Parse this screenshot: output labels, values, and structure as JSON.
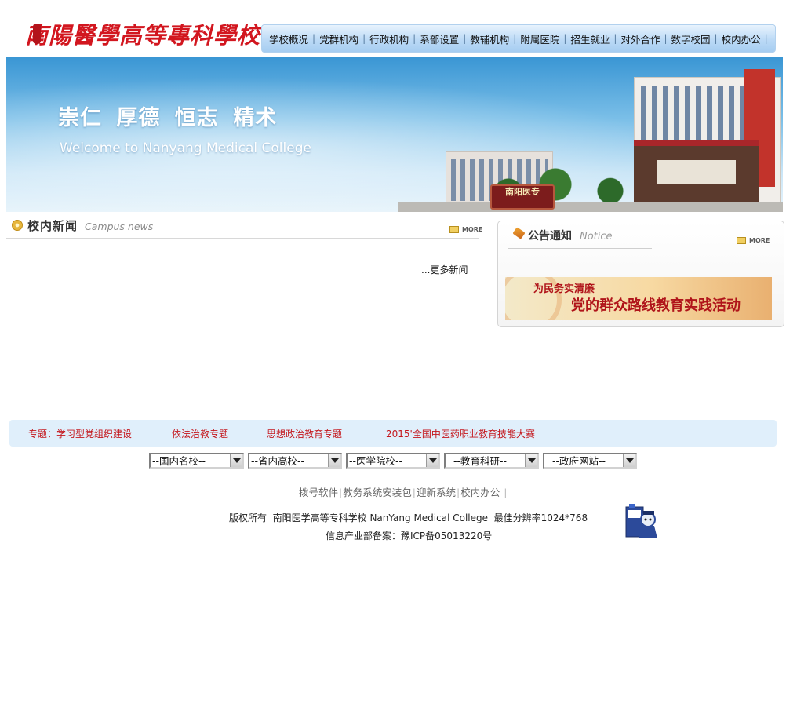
{
  "header": {
    "school_name": "南陽醫學高等專科學校",
    "nav": [
      "学校概况",
      "党群机构",
      "行政机构",
      "系部设置",
      "教辅机构",
      "附属医院",
      "招生就业",
      "对外合作",
      "数字校园",
      "校内办公"
    ],
    "nav_separator": "|"
  },
  "banner": {
    "motto": "崇仁 厚德 恒志 精术",
    "welcome": "Welcome to Nanyang Medical College",
    "stone_label": "南阳医专"
  },
  "news": {
    "title_cn": "校内新闻",
    "title_en": "Campus news",
    "more_label": "MORE",
    "more_news_link": "...更多新闻"
  },
  "notice": {
    "title_cn": "公告通知",
    "title_en": "Notice",
    "more_label": "MORE",
    "promo_line1": "为民务实清廉",
    "promo_line2": "党的群众路线教育实践活动"
  },
  "topics": [
    "专题：学习型党组织建设",
    "依法治教专题",
    "思想政治教育专题",
    "2015'全国中医药职业教育技能大赛"
  ],
  "selects": [
    "--国内名校--",
    "--省内高校--",
    "--医学院校--",
    "  --教育科研--",
    "  --政府网站--"
  ],
  "footer": {
    "links": [
      "拨号软件",
      "教务系统安装包",
      "迎新系统",
      "校内办公"
    ],
    "copyright": "版权所有  南阳医学高等专科学校 NanYang Medical College  最佳分辨率1024*768",
    "icp": "信息产业部备案：豫ICP备05013220号"
  }
}
